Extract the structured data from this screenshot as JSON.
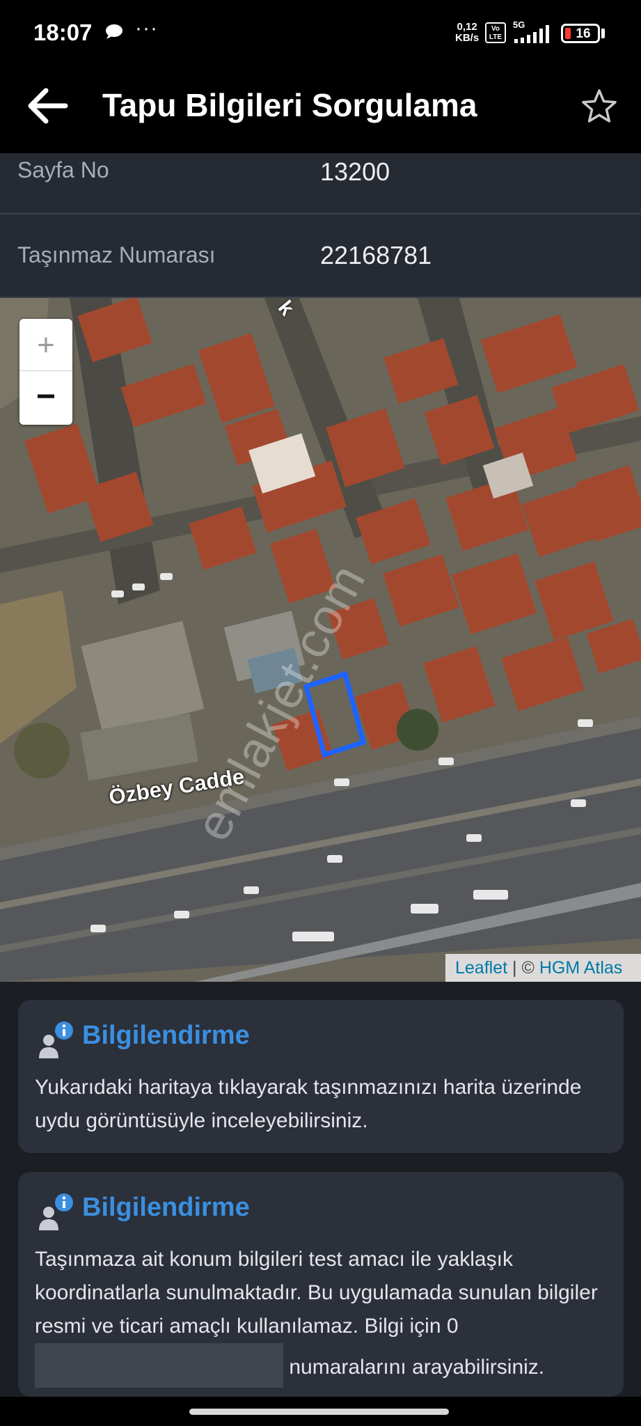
{
  "status_bar": {
    "time": "18:07",
    "more": "···",
    "net_speed": "0,12",
    "net_unit": "KB/s",
    "volte": "Vo LTE",
    "network": "5G",
    "battery": "16",
    "icons": [
      "chat-bubble-icon",
      "volte-icon",
      "signal-icon",
      "battery-icon"
    ]
  },
  "app_bar": {
    "title": "Tapu Bilgileri Sorgulama",
    "back_icon": "arrow-left-icon",
    "favorite_icon": "star-outline-icon"
  },
  "details": [
    {
      "label": "Sayfa No",
      "value": "13200"
    },
    {
      "label": "Taşınmaz Numarası",
      "value": "22168781"
    }
  ],
  "map": {
    "zoom_in": "+",
    "zoom_out": "−",
    "street_label": "Özbey Cadde",
    "street_top_label": "k",
    "watermark": "emlakjet.com",
    "attribution_leaflet": "Leaflet",
    "attribution_sep": " | © ",
    "attribution_provider": "HGM Atlas",
    "parcel_color": "#1e63ff"
  },
  "cards": [
    {
      "title": "Bilgilendirme",
      "body": "Yukarıdaki haritaya tıklayarak taşınmazınızı harita üzerinde uydu görüntüsüyle inceleyebilirsiniz."
    },
    {
      "title": "Bilgilendirme",
      "body_before": "Taşınmaza ait konum bilgileri test amacı ile yaklaşık koordinatlarla sunulmaktadır. Bu uygulamada sunulan bilgiler resmi ve ticari amaçlı kullanılamaz. Bilgi için 0",
      "body_after": " numaralarını arayabilirsiniz."
    }
  ],
  "colors": {
    "app_bar": "#000000",
    "background": "#1b1e23",
    "row_background": "#262a33",
    "card_background": "#2b303a",
    "accent": "#3b8fe0"
  }
}
